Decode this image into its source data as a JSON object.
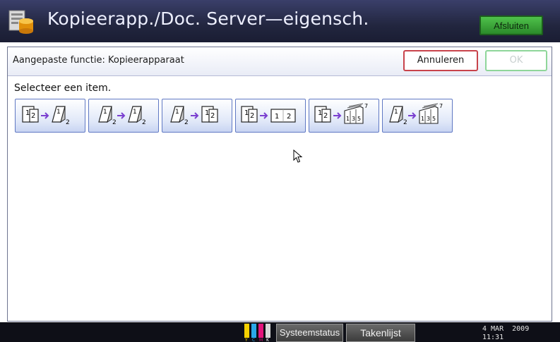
{
  "header": {
    "title": "Kopieerapp./Doc. Server—eigensch.",
    "exit_label": "Afsluiten",
    "icon": "copier-server-icon"
  },
  "subheader": {
    "label": "Aangepaste functie: Kopieerapparaat",
    "cancel_label": "Annuleren",
    "ok_label": "OK"
  },
  "main": {
    "prompt": "Selecteer een item.",
    "options": [
      {
        "name": "one-sided-to-two-sided",
        "src": [
          "1",
          "2"
        ],
        "dst": [
          "1",
          "2"
        ],
        "src_kind": "single",
        "dst_kind": "duplex"
      },
      {
        "name": "two-sided-to-two-sided",
        "src": [
          "1",
          "2"
        ],
        "dst": [
          "1",
          "2"
        ],
        "src_kind": "duplex",
        "dst_kind": "duplex"
      },
      {
        "name": "two-sided-to-one-sided",
        "src": [
          "1",
          "2"
        ],
        "dst": [
          "1",
          "2"
        ],
        "src_kind": "duplex",
        "dst_kind": "single"
      },
      {
        "name": "one-sided-to-combine",
        "src": [
          "1",
          "2"
        ],
        "dst": [
          "1",
          "2"
        ],
        "src_kind": "single",
        "dst_kind": "combine"
      },
      {
        "name": "one-sided-to-booklet",
        "src": [
          "1",
          "2"
        ],
        "dst": [
          "1",
          "3",
          "5",
          "7"
        ],
        "src_kind": "single",
        "dst_kind": "booklet"
      },
      {
        "name": "two-sided-to-booklet",
        "src": [
          "1",
          "2"
        ],
        "dst": [
          "1",
          "3",
          "5",
          "7"
        ],
        "src_kind": "duplex",
        "dst_kind": "booklet"
      }
    ]
  },
  "footer": {
    "toner_labels": [
      "Y",
      "C",
      "M",
      "K"
    ],
    "toner_colors": [
      "#f4d000",
      "#2aa8e8",
      "#e4147c",
      "#303030"
    ],
    "system_status_label": "Systeemstatus",
    "job_list_label": "Takenlijst",
    "date": "4 MAR  2009",
    "time": "11:31"
  },
  "colors": {
    "title_bar": "#22263f",
    "exit_button": "#3aa838",
    "cancel_border": "#c8434b",
    "ok_border": "#8fd69a",
    "option_border": "#5f78c3",
    "arrow": "#7a3fd0"
  }
}
